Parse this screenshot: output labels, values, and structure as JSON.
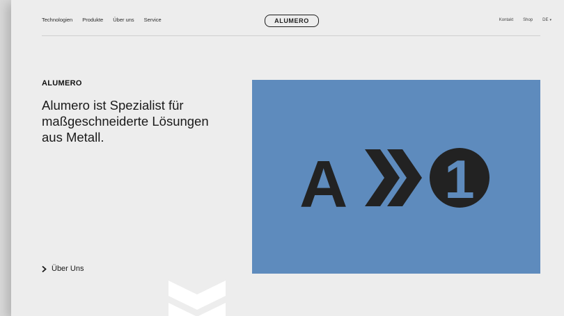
{
  "nav": {
    "left_items": [
      "Technologien",
      "Produkte",
      "Über uns",
      "Service"
    ],
    "logo": "ALUMERO",
    "kontakt": "Kontakt",
    "shop": "Shop",
    "language": "DE",
    "language_caret_icon": "chevron-down-icon"
  },
  "hero": {
    "eyebrow": "ALUMERO",
    "headline": "Alumero ist Spezialist für maßgeschneiderte Lösungen aus Metall.",
    "link_label": "Über Uns",
    "image_letter": "A",
    "image_number": "1"
  },
  "colors": {
    "background": "#ededed",
    "hero_blue": "#5e8bbd",
    "text_dark": "#1a1a1a"
  }
}
